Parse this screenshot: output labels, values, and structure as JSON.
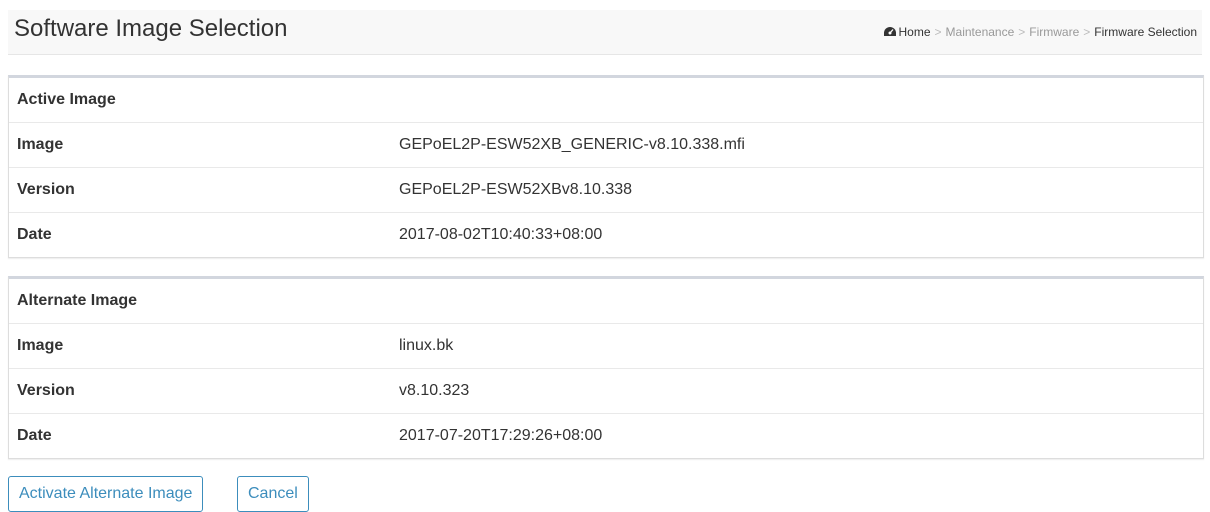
{
  "header": {
    "title": "Software Image Selection",
    "breadcrumb": {
      "home": "Home",
      "separator": ">",
      "items": [
        "Maintenance",
        "Firmware",
        "Firmware Selection"
      ]
    }
  },
  "active_image": {
    "heading": "Active Image",
    "rows": [
      {
        "label": "Image",
        "value": "GEPoEL2P-ESW52XB_GENERIC-v8.10.338.mfi"
      },
      {
        "label": "Version",
        "value": "GEPoEL2P-ESW52XBv8.10.338"
      },
      {
        "label": "Date",
        "value": "2017-08-02T10:40:33+08:00"
      }
    ]
  },
  "alternate_image": {
    "heading": "Alternate Image",
    "rows": [
      {
        "label": "Image",
        "value": "linux.bk"
      },
      {
        "label": "Version",
        "value": "v8.10.323"
      },
      {
        "label": "Date",
        "value": "2017-07-20T17:29:26+08:00"
      }
    ]
  },
  "buttons": {
    "activate": "Activate Alternate Image",
    "cancel": "Cancel"
  },
  "colors": {
    "accent": "#3c8dbc",
    "panel_top_border": "#d2d6de"
  }
}
